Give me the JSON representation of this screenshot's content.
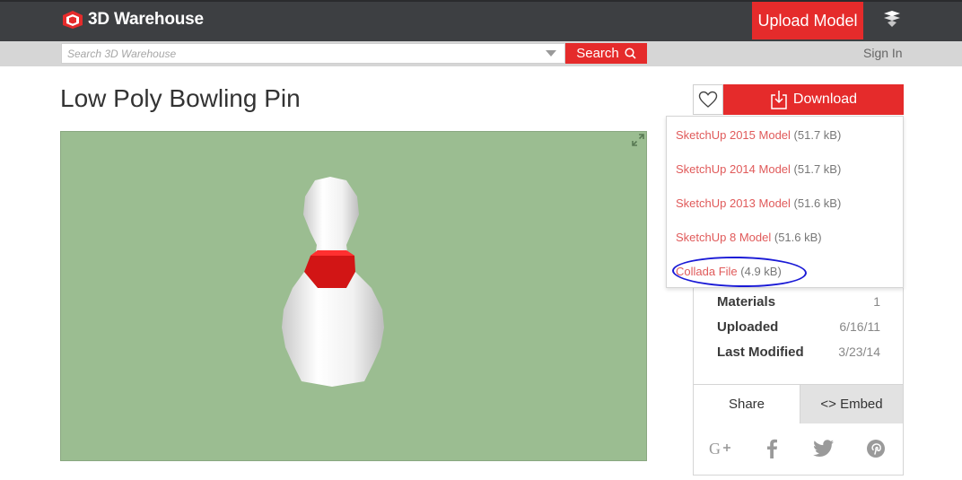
{
  "header": {
    "brand": "3D Warehouse",
    "upload_label": "Upload Model",
    "menu_icon": "sketchup-menu-icon"
  },
  "search": {
    "placeholder": "Search 3D Warehouse",
    "button_label": "Search",
    "signin_label": "Sign In"
  },
  "model": {
    "title": "Low Poly Bowling Pin"
  },
  "download": {
    "button_label": "Download",
    "options": [
      {
        "name": "SketchUp 2015 Model",
        "size": "(51.7 kB)"
      },
      {
        "name": "SketchUp 2014 Model",
        "size": "(51.7 kB)"
      },
      {
        "name": "SketchUp 2013 Model",
        "size": "(51.6 kB)"
      },
      {
        "name": "SketchUp 8 Model",
        "size": "(51.6 kB)"
      },
      {
        "name": "Collada File",
        "size": "(4.9 kB)"
      }
    ]
  },
  "details": {
    "rows": [
      {
        "label": "Materials",
        "value": "1"
      },
      {
        "label": "Uploaded",
        "value": "6/16/11"
      },
      {
        "label": "Last Modified",
        "value": "3/23/14"
      }
    ],
    "tabs": {
      "share": "Share",
      "embed": "<> Embed"
    }
  },
  "colors": {
    "brand_red": "#e52b2b",
    "topbar": "#3d3f42",
    "viewer_bg": "#9bbd91",
    "annotation": "#1a1ad6"
  }
}
